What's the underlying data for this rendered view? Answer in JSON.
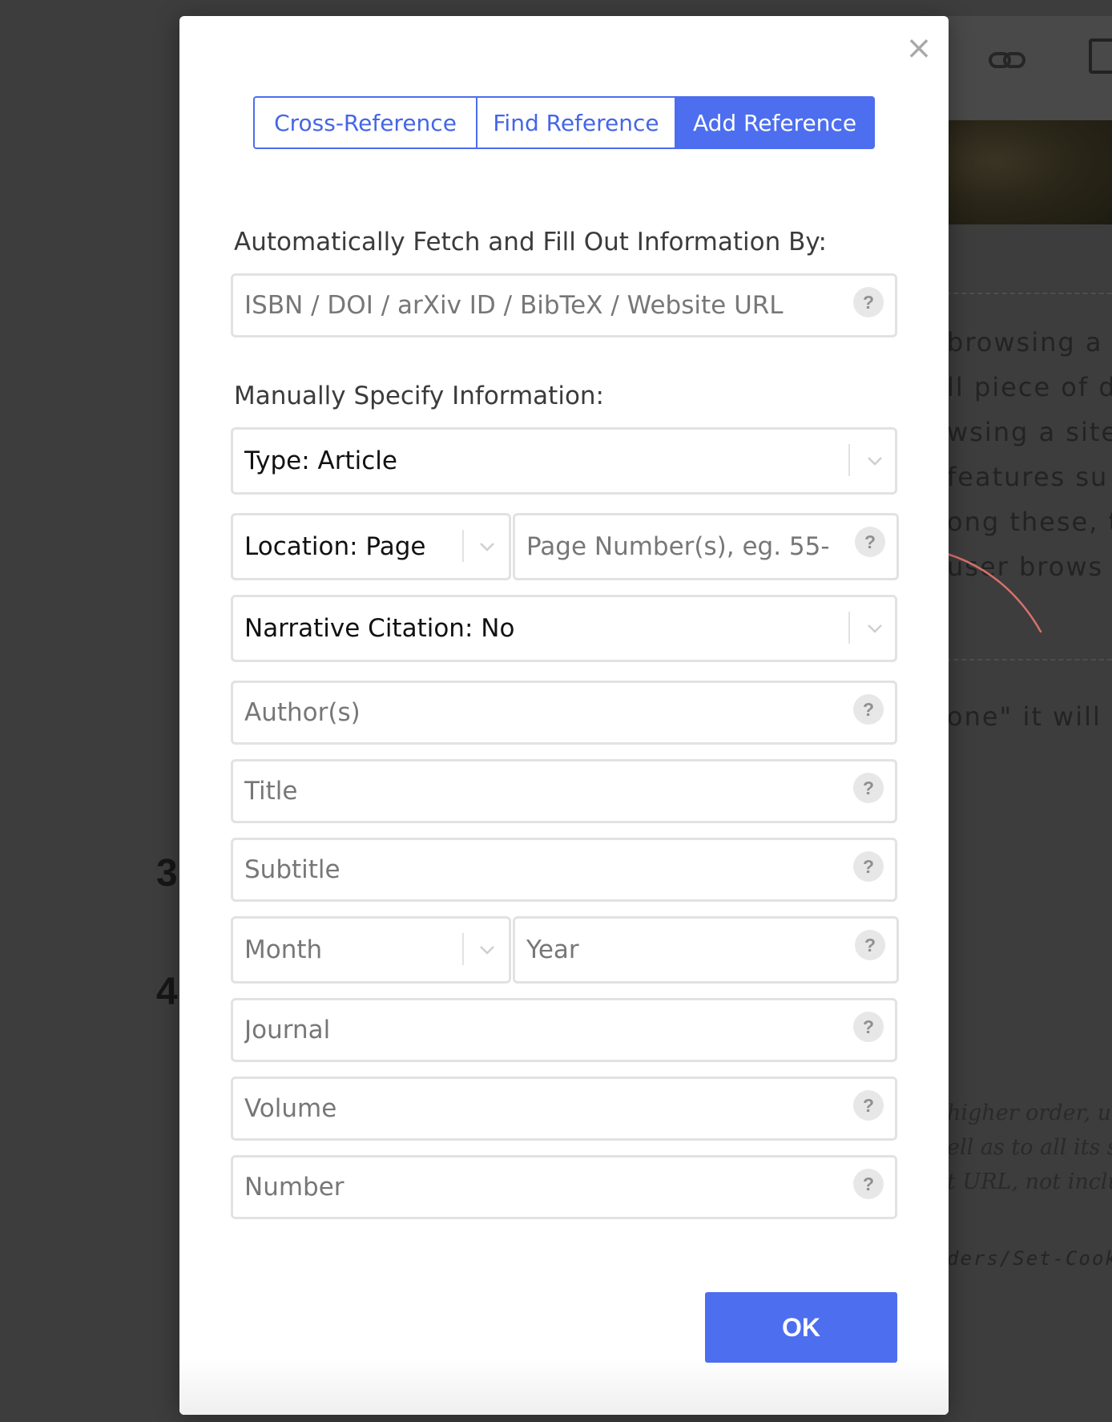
{
  "background": {
    "text_lines": [
      "browsing a",
      "ll piece of d",
      "wsing a site.",
      "features su",
      "ong these, t",
      "user brows"
    ],
    "quote_line": "one\" it will n",
    "italic_lines": [
      "higher order, unle",
      "ell as to all its sub",
      "t URL, not includ"
    ],
    "code_line": "ders/Set-Cookie",
    "list_numbers": [
      "3",
      "4"
    ]
  },
  "modal": {
    "close_label": "×",
    "tabs": [
      {
        "label": "Cross-Reference",
        "active": false
      },
      {
        "label": "Find Reference",
        "active": false
      },
      {
        "label": "Add Reference",
        "active": true
      }
    ],
    "auto_fetch": {
      "label": "Automatically Fetch and Fill Out Information By:",
      "placeholder": "ISBN / DOI / arXiv ID / BibTeX / Website URL"
    },
    "manual_label": "Manually Specify Information:",
    "type_select": {
      "value": "Type: Article"
    },
    "location_select": {
      "value": "Location: Page"
    },
    "page_numbers": {
      "placeholder": "Page Number(s), eg. 55-"
    },
    "narrative_select": {
      "value": "Narrative Citation: No"
    },
    "fields": {
      "authors": "Author(s)",
      "title": "Title",
      "subtitle": "Subtitle",
      "month": "Month",
      "year": "Year",
      "journal": "Journal",
      "volume": "Volume",
      "number": "Number"
    },
    "help_label": "?",
    "ok_label": "OK"
  },
  "colors": {
    "accent": "#4d6eef",
    "annotation_arrow": "#d9706b",
    "overlay": "#3d3d3d"
  }
}
